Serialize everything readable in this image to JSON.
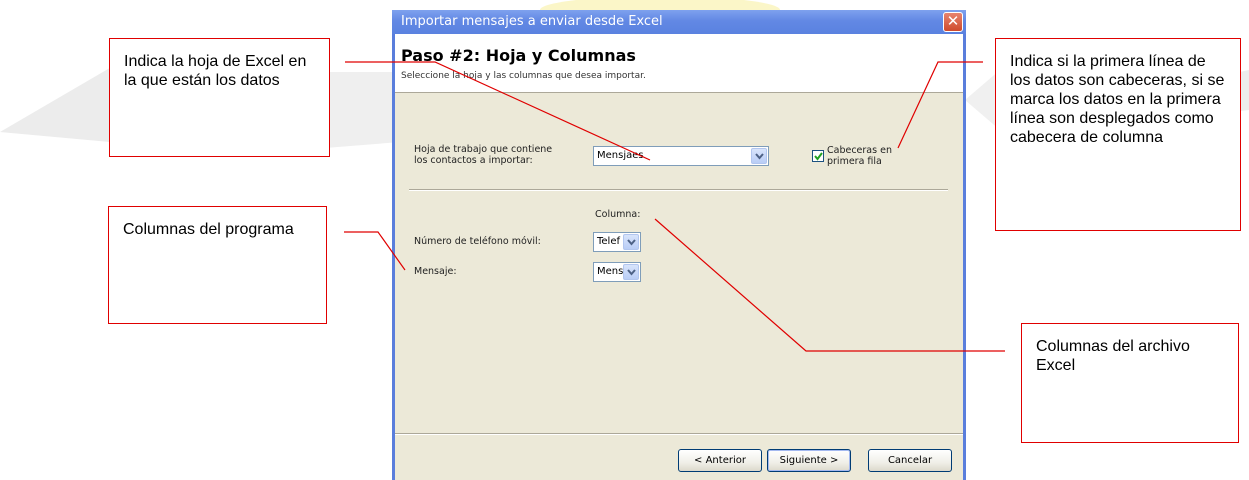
{
  "dialog": {
    "title": "Importar mensajes a enviar desde Excel",
    "close_glyph": "✕",
    "step_title": "Paso #2: Hoja y Columnas",
    "step_subtitle": "Seleccione la hoja y las columnas que desea importar.",
    "sheet_label_line1": "Hoja de trabajo que contiene",
    "sheet_label_line2": "los contactos a importar:",
    "sheet_value": "Mensjaes",
    "header_checkbox_line1": "Cabeceras en",
    "header_checkbox_line2": "primera fila",
    "header_checkbox_checked": true,
    "column_header": "Columna:",
    "fields": [
      {
        "label": "Número de teléfono móvil:",
        "value": "Telef"
      },
      {
        "label": "Mensaje:",
        "value": "Mens"
      }
    ],
    "buttons": {
      "back": "< Anterior",
      "next": "Siguiente >",
      "cancel": "Cancelar"
    }
  },
  "callouts": {
    "sheet": "Indica la hoja de Excel en la que están los datos",
    "program_columns": "Columnas del programa",
    "headers": "Indica si la primera línea de los datos son cabeceras, si se marca los datos en la primera línea son desplegados como cabecera de columna",
    "excel_columns": "Columnas del archivo Excel"
  },
  "colors": {
    "title_bar": "#6288e4",
    "callout_border": "#e00000",
    "dialog_body": "#ece9d8"
  }
}
